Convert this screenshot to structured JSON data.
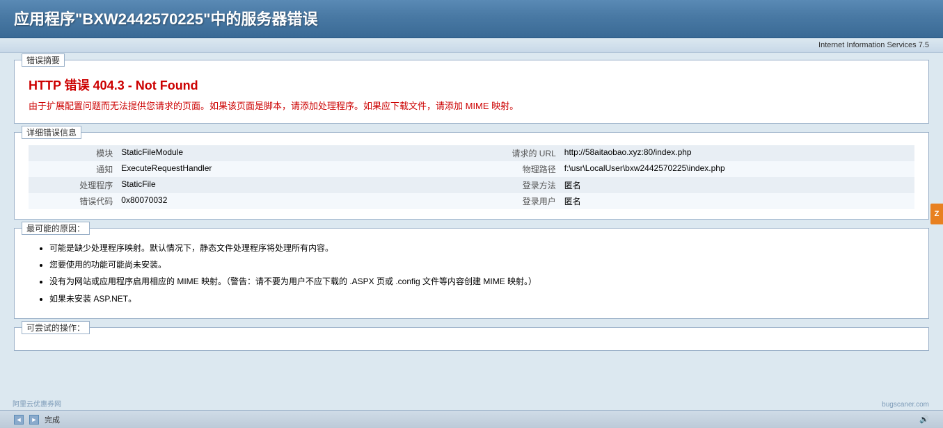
{
  "title_bar": {
    "heading": "应用程序\"BXW2442570225\"中的服务器错误"
  },
  "iis_bar": {
    "label": "Internet Information Services 7.5"
  },
  "error_summary": {
    "section_label": "错误摘要",
    "error_title": "HTTP 错误 404.3 - Not Found",
    "error_description": "由于扩展配置问题而无法提供您请求的页面。如果该页面是脚本，请添加处理程序。如果应下载文件，请添加 MIME 映射。"
  },
  "detail_info": {
    "section_label": "详细错误信息",
    "rows": [
      {
        "label": "模块",
        "value": "StaticFileModule"
      },
      {
        "label": "通知",
        "value": "ExecuteRequestHandler"
      },
      {
        "label": "处理程序",
        "value": "StaticFile"
      },
      {
        "label": "错误代码",
        "value": "0x80070032"
      }
    ],
    "rows_right": [
      {
        "label": "请求的 URL",
        "value": "http://58aitaobao.xyz:80/index.php"
      },
      {
        "label": "物理路径",
        "value": "f:\\usr\\LocalUser\\bxw2442570225\\index.php"
      },
      {
        "label": "登录方法",
        "value": "匿名"
      },
      {
        "label": "登录用户",
        "value": "匿名"
      }
    ]
  },
  "reasons": {
    "section_label": "最可能的原因：",
    "items": [
      "可能是缺少处理程序映射。默认情况下，静态文件处理程序将处理所有内容。",
      "您要使用的功能可能尚未安装。",
      "没有为网站或应用程序启用相应的 MIME 映射。（警告：请不要为用户不应下载的 .ASPX 页或 .config 文件等内容创建 MIME 映射。）",
      "如果未安装 ASP.NET。"
    ]
  },
  "try_section": {
    "section_label": "可尝试的操作："
  },
  "status_bar": {
    "nav_back": "◄",
    "nav_forward": "►",
    "status_text": "完成",
    "sound_icon": "🔊",
    "watermark_left": "阿里云优惠券网",
    "watermark_right": "bugscaner.com"
  },
  "orange_btn": {
    "label": "Z"
  }
}
